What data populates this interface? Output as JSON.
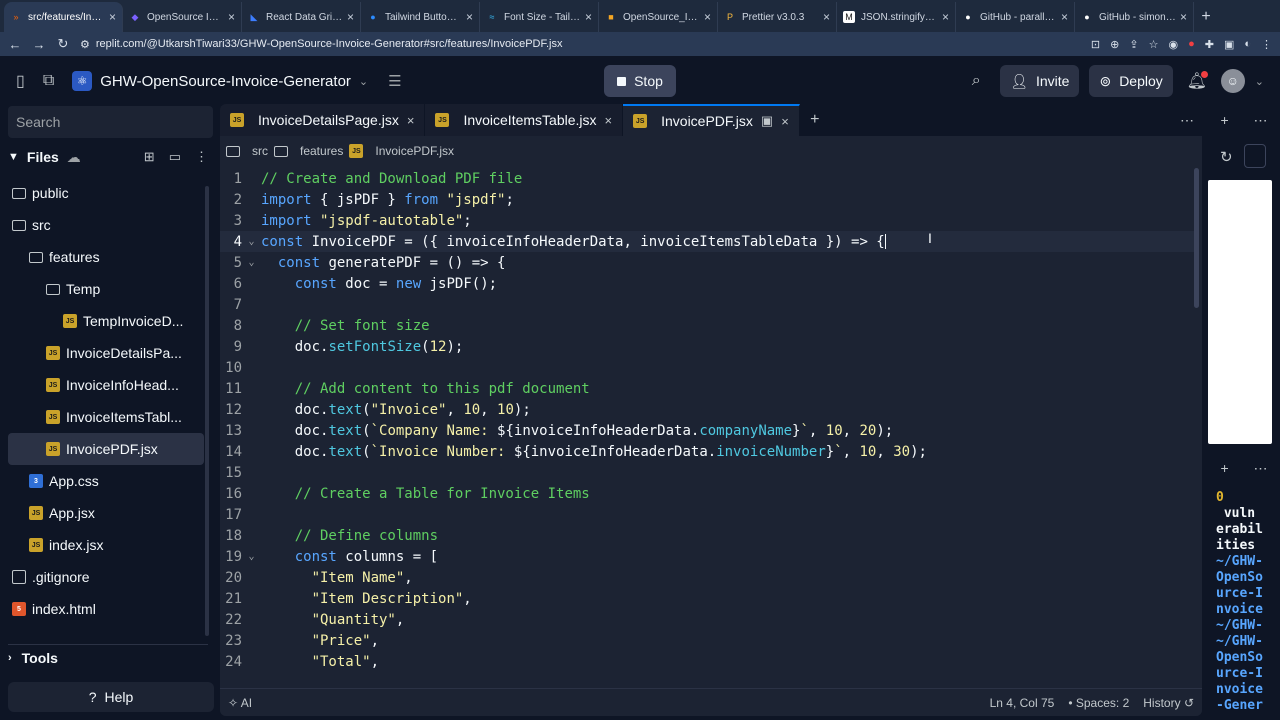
{
  "browser": {
    "tabs": [
      {
        "title": "src/features/Invoic",
        "fav": "»",
        "fav_color": "#f26207",
        "active": true
      },
      {
        "title": "OpenSource Invoic",
        "fav": "◆",
        "fav_color": "#7b61ff",
        "active": false
      },
      {
        "title": "React Data Grid: Ro",
        "fav": "◣",
        "fav_color": "#3d7eff",
        "active": false
      },
      {
        "title": "Tailwind Button Co",
        "fav": "●",
        "fav_color": "#2c8cff",
        "active": false
      },
      {
        "title": "Font Size - Tailwind",
        "fav": "≈",
        "fav_color": "#38bdf8",
        "active": false
      },
      {
        "title": "OpenSource_Invoic",
        "fav": "■",
        "fav_color": "#f5a623",
        "active": false
      },
      {
        "title": "Prettier v3.0.3",
        "fav": "P",
        "fav_color": "#f7b93e",
        "active": false
      },
      {
        "title": "JSON.stringify() - J",
        "fav": "M",
        "fav_color": "#1a1a1a",
        "active": false
      },
      {
        "title": "GitHub - parallax/js",
        "fav": "●",
        "fav_color": "#ffffff",
        "active": false
      },
      {
        "title": "GitHub - simonben",
        "fav": "●",
        "fav_color": "#ffffff",
        "active": false
      }
    ],
    "url": "replit.com/@UtkarshTiwari33/GHW-OpenSource-Invoice-Generator#src/features/InvoicePDF.jsx"
  },
  "header": {
    "repl_name": "GHW-OpenSource-Invoice-Generator",
    "stop_label": "Stop",
    "invite_label": "Invite",
    "deploy_label": "Deploy"
  },
  "sidebar": {
    "search_placeholder": "Search",
    "files_label": "Files",
    "tree": [
      {
        "name": "public",
        "type": "folder",
        "indent": 0
      },
      {
        "name": "src",
        "type": "folder",
        "indent": 0
      },
      {
        "name": "features",
        "type": "folder",
        "indent": 1
      },
      {
        "name": "Temp",
        "type": "folder",
        "indent": 2
      },
      {
        "name": "TempInvoiceD...",
        "type": "js",
        "indent": 3
      },
      {
        "name": "InvoiceDetailsPa...",
        "type": "js",
        "indent": 2
      },
      {
        "name": "InvoiceInfoHead...",
        "type": "js",
        "indent": 2
      },
      {
        "name": "InvoiceItemsTabl...",
        "type": "js",
        "indent": 2
      },
      {
        "name": "InvoicePDF.jsx",
        "type": "js",
        "indent": 2,
        "selected": true
      },
      {
        "name": "App.css",
        "type": "css",
        "indent": 1
      },
      {
        "name": "App.jsx",
        "type": "js",
        "indent": 1
      },
      {
        "name": "index.jsx",
        "type": "js",
        "indent": 1
      },
      {
        "name": ".gitignore",
        "type": "git",
        "indent": 0
      },
      {
        "name": "index.html",
        "type": "html",
        "indent": 0
      }
    ],
    "tools_label": "Tools",
    "help_label": "Help"
  },
  "editor": {
    "tabs": [
      {
        "label": "InvoiceDetailsPage.jsx",
        "active": false
      },
      {
        "label": "InvoiceItemsTable.jsx",
        "active": false
      },
      {
        "label": "InvoicePDF.jsx",
        "active": true
      }
    ],
    "breadcrumb": [
      "src",
      "features",
      "InvoicePDF.jsx"
    ],
    "lines": [
      {
        "n": "1",
        "tokens": [
          [
            "cm",
            "// Create and Download PDF file"
          ]
        ]
      },
      {
        "n": "2",
        "tokens": [
          [
            "kw",
            "import"
          ],
          [
            "code",
            " { jsPDF } "
          ],
          [
            "kw",
            "from"
          ],
          [
            "str",
            " \"jspdf\""
          ],
          [
            "code",
            ";"
          ]
        ]
      },
      {
        "n": "3",
        "tokens": [
          [
            "kw",
            "import"
          ],
          [
            "str",
            " \"jspdf-autotable\""
          ],
          [
            "code",
            ";"
          ]
        ]
      },
      {
        "n": "4",
        "cur": true,
        "fold": true,
        "tokens": [
          [
            "kw",
            "const"
          ],
          [
            "code",
            " InvoicePDF = ({ invoiceInfoHeaderData, invoiceItemsTableData }) => {"
          ]
        ]
      },
      {
        "n": "5",
        "fold": true,
        "tokens": [
          [
            "code",
            "  "
          ],
          [
            "kw",
            "const"
          ],
          [
            "code",
            " generatePDF = () => {"
          ]
        ]
      },
      {
        "n": "6",
        "tokens": [
          [
            "code",
            "    "
          ],
          [
            "kw",
            "const"
          ],
          [
            "code",
            " doc = "
          ],
          [
            "kw",
            "new"
          ],
          [
            "code",
            " jsPDF();"
          ]
        ]
      },
      {
        "n": "7",
        "tokens": []
      },
      {
        "n": "8",
        "tokens": [
          [
            "code",
            "    "
          ],
          [
            "cm",
            "// Set font size"
          ]
        ]
      },
      {
        "n": "9",
        "tokens": [
          [
            "code",
            "    doc."
          ],
          [
            "prop",
            "setFontSize"
          ],
          [
            "code",
            "("
          ],
          [
            "num",
            "12"
          ],
          [
            "code",
            ");"
          ]
        ]
      },
      {
        "n": "10",
        "tokens": []
      },
      {
        "n": "11",
        "tokens": [
          [
            "code",
            "    "
          ],
          [
            "cm",
            "// Add content to this pdf document"
          ]
        ]
      },
      {
        "n": "12",
        "tokens": [
          [
            "code",
            "    doc."
          ],
          [
            "prop",
            "text"
          ],
          [
            "code",
            "("
          ],
          [
            "str",
            "\"Invoice\""
          ],
          [
            "code",
            ", "
          ],
          [
            "num",
            "10"
          ],
          [
            "code",
            ", "
          ],
          [
            "num",
            "10"
          ],
          [
            "code",
            ");"
          ]
        ]
      },
      {
        "n": "13",
        "tokens": [
          [
            "code",
            "    doc."
          ],
          [
            "prop",
            "text"
          ],
          [
            "code",
            "("
          ],
          [
            "str",
            "`Company Name: "
          ],
          [
            "code",
            "${invoiceInfoHeaderData."
          ],
          [
            "prop",
            "companyName"
          ],
          [
            "code",
            "}"
          ],
          [
            "str",
            "`"
          ],
          [
            "code",
            ", "
          ],
          [
            "num",
            "10"
          ],
          [
            "code",
            ", "
          ],
          [
            "num",
            "20"
          ],
          [
            "code",
            ");"
          ]
        ]
      },
      {
        "n": "14",
        "tokens": [
          [
            "code",
            "    doc."
          ],
          [
            "prop",
            "text"
          ],
          [
            "code",
            "("
          ],
          [
            "str",
            "`Invoice Number: "
          ],
          [
            "code",
            "${invoiceInfoHeaderData."
          ],
          [
            "prop",
            "invoiceNumber"
          ],
          [
            "code",
            "}"
          ],
          [
            "str",
            "`"
          ],
          [
            "code",
            ", "
          ],
          [
            "num",
            "10"
          ],
          [
            "code",
            ", "
          ],
          [
            "num",
            "30"
          ],
          [
            "code",
            ");"
          ]
        ]
      },
      {
        "n": "15",
        "tokens": []
      },
      {
        "n": "16",
        "tokens": [
          [
            "code",
            "    "
          ],
          [
            "cm",
            "// Create a Table for Invoice Items"
          ]
        ]
      },
      {
        "n": "17",
        "tokens": []
      },
      {
        "n": "18",
        "tokens": [
          [
            "code",
            "    "
          ],
          [
            "cm",
            "// Define columns"
          ]
        ]
      },
      {
        "n": "19",
        "fold": true,
        "tokens": [
          [
            "code",
            "    "
          ],
          [
            "kw",
            "const"
          ],
          [
            "code",
            " columns = ["
          ]
        ]
      },
      {
        "n": "20",
        "tokens": [
          [
            "code",
            "      "
          ],
          [
            "str",
            "\"Item Name\""
          ],
          [
            "code",
            ","
          ]
        ]
      },
      {
        "n": "21",
        "tokens": [
          [
            "code",
            "      "
          ],
          [
            "str",
            "\"Item Description\""
          ],
          [
            "code",
            ","
          ]
        ]
      },
      {
        "n": "22",
        "tokens": [
          [
            "code",
            "      "
          ],
          [
            "str",
            "\"Quantity\""
          ],
          [
            "code",
            ","
          ]
        ]
      },
      {
        "n": "23",
        "tokens": [
          [
            "code",
            "      "
          ],
          [
            "str",
            "\"Price\""
          ],
          [
            "code",
            ","
          ]
        ]
      },
      {
        "n": "24",
        "tokens": [
          [
            "code",
            "      "
          ],
          [
            "str",
            "\"Total\""
          ],
          [
            "code",
            ","
          ]
        ]
      }
    ],
    "status": {
      "ai": "AI",
      "position": "Ln 4, Col 75",
      "spaces": "Spaces: 2",
      "history": "History"
    }
  },
  "console": {
    "lines": [
      {
        "cls": "y",
        "text": "0"
      },
      {
        "cls": "",
        "text": " vuln"
      },
      {
        "cls": "",
        "text": "erabil"
      },
      {
        "cls": "",
        "text": "ities"
      },
      {
        "cls": "b",
        "text": "~/GHW-"
      },
      {
        "cls": "b",
        "text": "OpenSo"
      },
      {
        "cls": "b",
        "text": "urce-I"
      },
      {
        "cls": "b",
        "text": "nvoice"
      },
      {
        "cls": "b",
        "text": "~/GHW-"
      },
      {
        "cls": "b",
        "text": "~/GHW-"
      },
      {
        "cls": "b",
        "text": "OpenSo"
      },
      {
        "cls": "b",
        "text": "urce-I"
      },
      {
        "cls": "b",
        "text": "nvoice"
      },
      {
        "cls": "b",
        "text": "-Gener"
      }
    ]
  }
}
